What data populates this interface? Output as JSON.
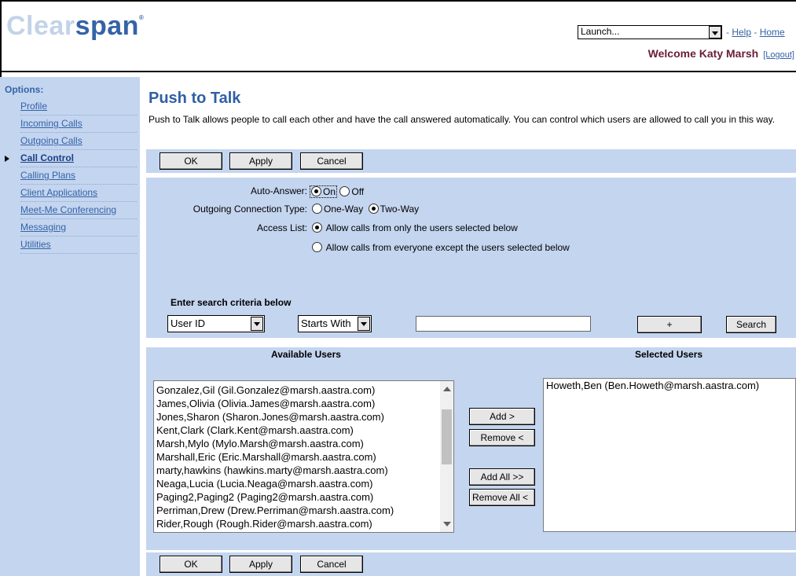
{
  "brand": {
    "part1": "Clear",
    "part2": "span",
    "mark": "®"
  },
  "header": {
    "launch_value": "Launch...",
    "links": {
      "help": "Help",
      "home": "Home",
      "sep": "-"
    },
    "welcome": "Welcome Katy Marsh",
    "logout": "[Logout]"
  },
  "sidebar": {
    "title": "Options:",
    "items": [
      {
        "label": "Profile"
      },
      {
        "label": "Incoming Calls"
      },
      {
        "label": "Outgoing Calls"
      },
      {
        "label": "Call Control"
      },
      {
        "label": "Calling Plans"
      },
      {
        "label": "Client Applications"
      },
      {
        "label": "Meet-Me Conferencing"
      },
      {
        "label": "Messaging"
      },
      {
        "label": "Utilities"
      }
    ]
  },
  "page": {
    "title": "Push to Talk",
    "description": "Push to Talk allows people to call each other and have the call answered automatically. You can control which users are allowed to call you in this way."
  },
  "buttons": {
    "ok": "OK",
    "apply": "Apply",
    "cancel": "Cancel"
  },
  "form": {
    "auto_answer": {
      "label": "Auto-Answer:",
      "on": "On",
      "off": "Off",
      "selected": "On"
    },
    "connection": {
      "label": "Outgoing Connection Type:",
      "one_way": "One-Way",
      "two_way": "Two-Way",
      "selected": "Two-Way"
    },
    "access": {
      "label": "Access List:",
      "only": "Allow calls from only the users selected below",
      "except": "Allow calls from everyone except the users selected below",
      "selected": "only"
    }
  },
  "search": {
    "title": "Enter search criteria below",
    "field": "User ID",
    "mode": "Starts With",
    "value": "",
    "plus": "+",
    "search_label": "Search"
  },
  "lists": {
    "available_title": "Available Users",
    "selected_title": "Selected Users",
    "available": [
      "Gonzalez,Gil (Gil.Gonzalez@marsh.aastra.com)",
      "James,Olivia (Olivia.James@marsh.aastra.com)",
      "Jones,Sharon (Sharon.Jones@marsh.aastra.com)",
      "Kent,Clark (Clark.Kent@marsh.aastra.com)",
      "Marsh,Mylo (Mylo.Marsh@marsh.aastra.com)",
      "Marshall,Eric (Eric.Marshall@marsh.aastra.com)",
      "marty,hawkins (hawkins.marty@marsh.aastra.com)",
      "Neaga,Lucia (Lucia.Neaga@marsh.aastra.com)",
      "Paging2,Paging2 (Paging2@marsh.aastra.com)",
      "Perriman,Drew (Drew.Perriman@marsh.aastra.com)",
      "Rider,Rough (Rough.Rider@marsh.aastra.com)"
    ],
    "selected": [
      "Howeth,Ben (Ben.Howeth@marsh.aastra.com)"
    ],
    "add": "Add >",
    "remove": "Remove <",
    "add_all": "Add All >>",
    "remove_all": "Remove All <"
  }
}
